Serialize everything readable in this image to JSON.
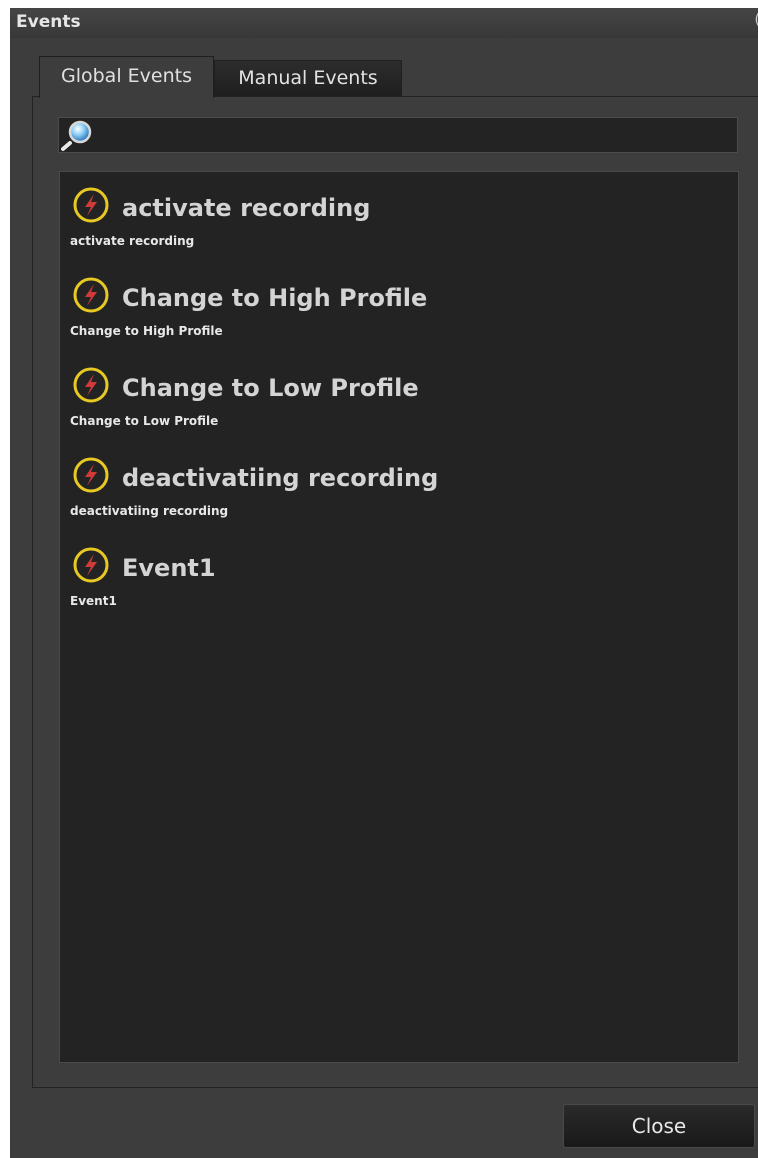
{
  "window": {
    "title": "Events",
    "corner_char": "("
  },
  "tabs": [
    {
      "label": "Global Events",
      "active": true
    },
    {
      "label": "Manual Events",
      "active": false
    }
  ],
  "search": {
    "value": "",
    "placeholder": "",
    "icon": "magnifier-icon"
  },
  "events": [
    {
      "title": "activate recording",
      "subtitle": "activate recording",
      "icon": "event-lightning-icon"
    },
    {
      "title": "Change to High Profile",
      "subtitle": "Change to High Profile",
      "icon": "event-lightning-icon"
    },
    {
      "title": "Change to Low Profile",
      "subtitle": "Change to Low Profile",
      "icon": "event-lightning-icon"
    },
    {
      "title": "deactivatiing recording",
      "subtitle": "deactivatiing recording",
      "icon": "event-lightning-icon"
    },
    {
      "title": "Event1",
      "subtitle": "Event1",
      "icon": "event-lightning-icon"
    }
  ],
  "buttons": {
    "close_label": "Close"
  },
  "colors": {
    "background": "#3d3d3d",
    "list_background": "#232323",
    "icon_ring": "#e8c822",
    "icon_bolt": "#d23a3a"
  }
}
